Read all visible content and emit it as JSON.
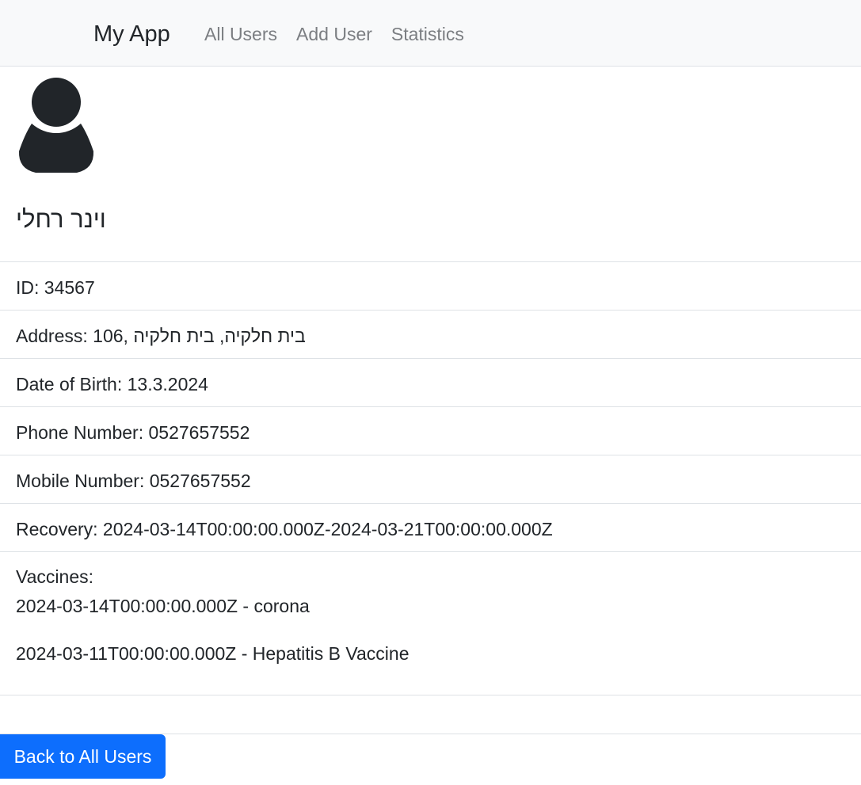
{
  "navbar": {
    "brand": "My App",
    "links": [
      "All Users",
      "Add User",
      "Statistics"
    ]
  },
  "profile": {
    "avatar_icon": "user-icon",
    "name": "וינר רחלי"
  },
  "details": {
    "id": "ID: 34567",
    "address": "Address: 106, בית חלקיה, בית חלקיה",
    "dob": "Date of Birth: 13.3.2024",
    "phone": "Phone Number: 0527657552",
    "mobile": "Mobile Number: 0527657552",
    "recovery": "Recovery: 2024-03-14T00:00:00.000Z-2024-03-21T00:00:00.000Z",
    "vaccines_label": "Vaccines:",
    "vaccines": [
      "2024-03-14T00:00:00.000Z - corona",
      "2024-03-11T00:00:00.000Z - Hepatitis B Vaccine"
    ]
  },
  "actions": {
    "back_label": "Back to All Users"
  },
  "colors": {
    "primary": "#0d6efd",
    "navbar_bg": "#f8f9fa",
    "nav_link": "#7b7e82",
    "divider": "#dee2e6"
  }
}
